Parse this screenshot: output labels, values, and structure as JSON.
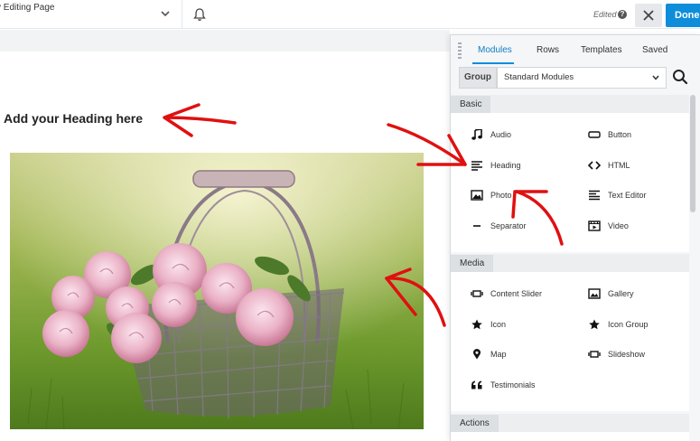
{
  "toolbar": {
    "page_title": "y Editing Page",
    "edited_label": "Edited",
    "help_glyph": "?",
    "done_label": "Done"
  },
  "page": {
    "heading": "Add your Heading here"
  },
  "panel": {
    "tabs": [
      {
        "label": "Modules",
        "active": true
      },
      {
        "label": "Rows",
        "active": false
      },
      {
        "label": "Templates",
        "active": false
      },
      {
        "label": "Saved",
        "active": false
      }
    ],
    "group_label": "Group",
    "group_value": "Standard Modules",
    "sections": {
      "basic": {
        "title": "Basic",
        "items": [
          {
            "label": "Audio",
            "icon": "music-note-icon"
          },
          {
            "label": "Button",
            "icon": "button-icon"
          },
          {
            "label": "Heading",
            "icon": "heading-lines-icon"
          },
          {
            "label": "HTML",
            "icon": "code-icon"
          },
          {
            "label": "Photo",
            "icon": "photo-icon"
          },
          {
            "label": "Text Editor",
            "icon": "text-editor-icon"
          },
          {
            "label": "Separator",
            "icon": "separator-icon"
          },
          {
            "label": "Video",
            "icon": "video-icon"
          }
        ]
      },
      "media": {
        "title": "Media",
        "items": [
          {
            "label": "Content Slider",
            "icon": "slider-icon"
          },
          {
            "label": "Gallery",
            "icon": "gallery-icon"
          },
          {
            "label": "Icon",
            "icon": "star-icon"
          },
          {
            "label": "Icon Group",
            "icon": "star-icon"
          },
          {
            "label": "Map",
            "icon": "map-pin-icon"
          },
          {
            "label": "Slideshow",
            "icon": "slideshow-icon"
          },
          {
            "label": "Testimonials",
            "icon": "quote-icon"
          }
        ]
      },
      "actions": {
        "title": "Actions"
      }
    }
  },
  "colors": {
    "accent": "#0e8ddb",
    "annotation": "#e01010"
  }
}
